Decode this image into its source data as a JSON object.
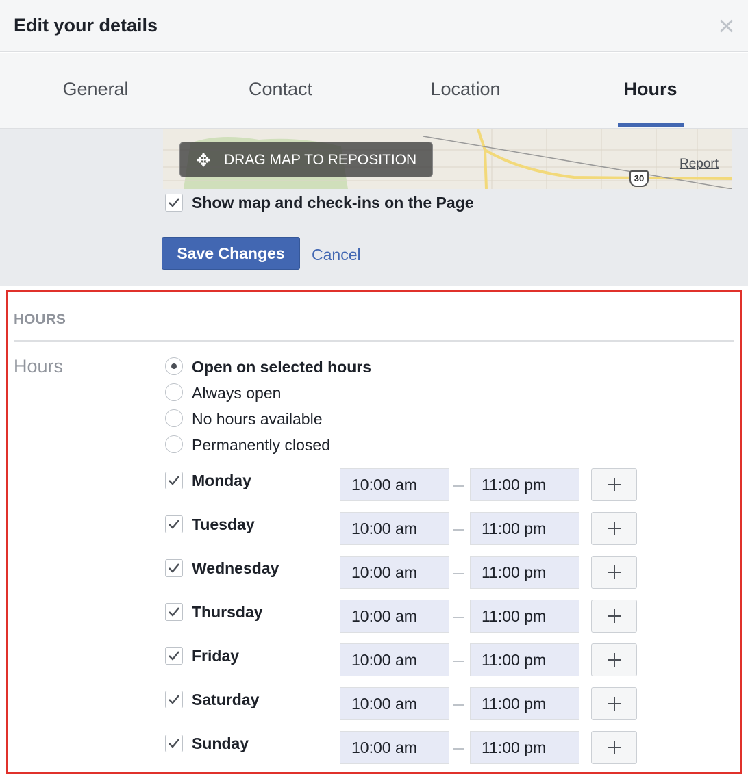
{
  "dialog": {
    "title": "Edit your details"
  },
  "tabs": [
    {
      "label": "General"
    },
    {
      "label": "Contact"
    },
    {
      "label": "Location"
    },
    {
      "label": "Hours"
    }
  ],
  "active_tab": "Hours",
  "map": {
    "drag_label": "DRAG MAP TO REPOSITION",
    "report_link": "Report",
    "route_shield": "30"
  },
  "show_map_checkbox": {
    "label": "Show map and check-ins on the Page",
    "checked": true
  },
  "actions": {
    "save_label": "Save Changes",
    "cancel_label": "Cancel"
  },
  "hours_section": {
    "title": "HOURS",
    "field_label": "Hours",
    "options": [
      {
        "label": "Open on selected hours",
        "selected": true
      },
      {
        "label": "Always open",
        "selected": false
      },
      {
        "label": "No hours available",
        "selected": false
      },
      {
        "label": "Permanently closed",
        "selected": false
      }
    ],
    "days": [
      {
        "name": "Monday",
        "checked": true,
        "open": "10:00 am",
        "close": "11:00 pm"
      },
      {
        "name": "Tuesday",
        "checked": true,
        "open": "10:00 am",
        "close": "11:00 pm"
      },
      {
        "name": "Wednesday",
        "checked": true,
        "open": "10:00 am",
        "close": "11:00 pm"
      },
      {
        "name": "Thursday",
        "checked": true,
        "open": "10:00 am",
        "close": "11:00 pm"
      },
      {
        "name": "Friday",
        "checked": true,
        "open": "10:00 am",
        "close": "11:00 pm"
      },
      {
        "name": "Saturday",
        "checked": true,
        "open": "10:00 am",
        "close": "11:00 pm"
      },
      {
        "name": "Sunday",
        "checked": true,
        "open": "10:00 am",
        "close": "11:00 pm"
      }
    ]
  },
  "colors": {
    "accent": "#4267b2",
    "highlight_border": "#e0312b",
    "time_field_bg": "#e7eaf6"
  }
}
